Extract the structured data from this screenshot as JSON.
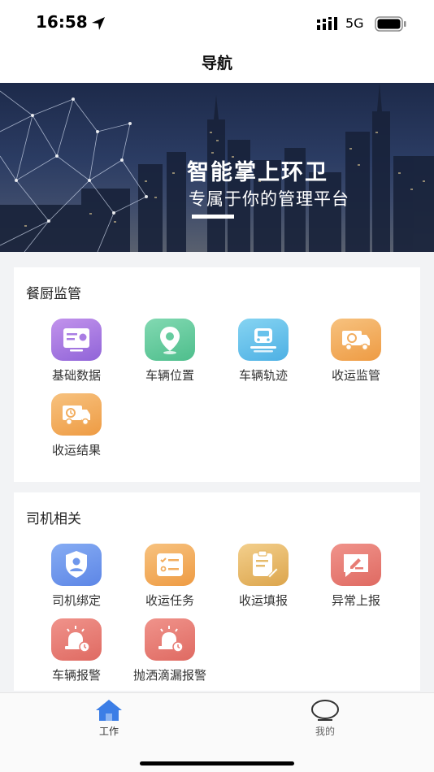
{
  "status_bar": {
    "time": "16:58",
    "network": "5G",
    "icons": [
      "location-arrow-icon",
      "signal-icon",
      "battery-icon"
    ]
  },
  "nav": {
    "title": "导航"
  },
  "banner": {
    "title": "智能掌上环卫",
    "subtitle": "专属于你的管理平台"
  },
  "sections": [
    {
      "title": "餐厨监管",
      "items": [
        {
          "label": "基础数据",
          "icon": "data-card-icon",
          "color": "#a97de3"
        },
        {
          "label": "车辆位置",
          "icon": "location-pin-icon",
          "color": "#66cc9f"
        },
        {
          "label": "车辆轨迹",
          "icon": "vehicle-track-icon",
          "color": "#67c2ec"
        },
        {
          "label": "收运监管",
          "icon": "recycle-truck-icon",
          "color": "#f2ad5e"
        },
        {
          "label": "收运结果",
          "icon": "clock-truck-icon",
          "color": "#f2ad5e"
        }
      ]
    },
    {
      "title": "司机相关",
      "items": [
        {
          "label": "司机绑定",
          "icon": "driver-shield-icon",
          "color": "#6f97ec"
        },
        {
          "label": "收运任务",
          "icon": "task-list-icon",
          "color": "#f2ad5e"
        },
        {
          "label": "收运填报",
          "icon": "clipboard-edit-icon",
          "color": "#e6bb6c"
        },
        {
          "label": "异常上报",
          "icon": "report-chat-icon",
          "color": "#e77c74"
        },
        {
          "label": "车辆报警",
          "icon": "alarm-siren-icon",
          "color": "#e77c74"
        },
        {
          "label": "抛洒滴漏报警",
          "icon": "alarm-siren-icon",
          "color": "#e77c74"
        }
      ]
    }
  ],
  "tabs": [
    {
      "label": "工作",
      "icon": "home-icon",
      "active": true,
      "color": "#3c7ee6"
    },
    {
      "label": "我的",
      "icon": "profile-icon",
      "active": false
    }
  ]
}
